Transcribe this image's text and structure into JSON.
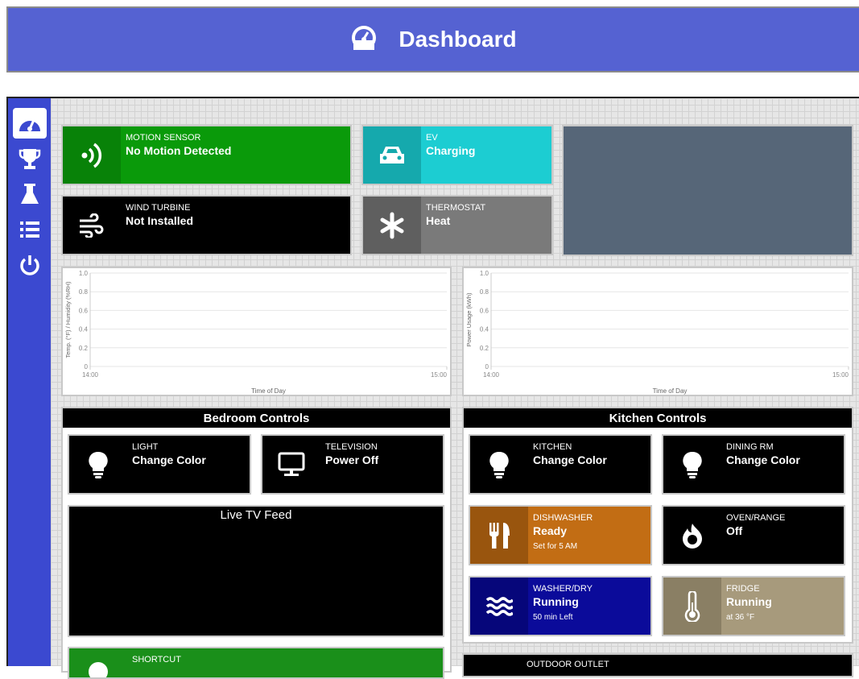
{
  "header": {
    "title": "Dashboard",
    "icon": "gauge-icon"
  },
  "sidebar": {
    "items": [
      {
        "name": "dashboard",
        "icon": "gauge-icon",
        "active": true
      },
      {
        "name": "trophy",
        "icon": "trophy-icon"
      },
      {
        "name": "flask",
        "icon": "flask-icon"
      },
      {
        "name": "list",
        "icon": "list-icon"
      },
      {
        "name": "power",
        "icon": "power-icon"
      }
    ]
  },
  "tiles": {
    "motion": {
      "label": "MOTION SENSOR",
      "value": "No Motion Detected",
      "color": "#0a9a0a",
      "icon_bg": "#088208"
    },
    "ev": {
      "label": "EV",
      "value": "Charging",
      "color": "#1ccdd2",
      "icon_bg": "#15a9ad"
    },
    "wind": {
      "label": "WIND TURBINE",
      "value": "Not Installed",
      "color": "#000000"
    },
    "thermostat": {
      "label": "THERMOSTAT",
      "value": "Heat",
      "color": "#7a7a7a",
      "icon_bg": "#5f5f5f"
    },
    "blank_color": "#566678"
  },
  "charts": [
    {
      "chart_data": {
        "type": "line",
        "ylabel": "Temp. (°F) / Humidity (%RH)",
        "xlabel": "Time of Day",
        "y_ticks": [
          "1.0",
          "0.8",
          "0.6",
          "0.4",
          "0.2",
          "0"
        ],
        "x_ticks": [
          "14:00",
          "15:00"
        ],
        "ylim": [
          0,
          1
        ],
        "series": []
      }
    },
    {
      "chart_data": {
        "type": "line",
        "ylabel": "Power Usage (kWh)",
        "xlabel": "Time of Day",
        "y_ticks": [
          "1.0",
          "0.8",
          "0.6",
          "0.4",
          "0.2",
          "0"
        ],
        "x_ticks": [
          "14:00",
          "15:00"
        ],
        "ylim": [
          0,
          1
        ],
        "series": []
      }
    }
  ],
  "bedroom": {
    "title": "Bedroom Controls",
    "light": {
      "label": "LIGHT",
      "value": "Change Color"
    },
    "tv": {
      "label": "TELEVISION",
      "value": "Power Off"
    },
    "feed": "Live TV Feed",
    "shortcut": {
      "label": "SHORTCUT",
      "color": "#1a8f1a"
    }
  },
  "kitchen": {
    "title": "Kitchen Controls",
    "kitchen_light": {
      "label": "KITCHEN",
      "value": "Change Color"
    },
    "dining": {
      "label": "DINING RM",
      "value": "Change Color"
    },
    "dishwasher": {
      "label": "DISHWASHER",
      "value": "Ready",
      "sub": "Set for 5 AM",
      "color": "#c26d14",
      "icon_bg": "#99550e"
    },
    "oven": {
      "label": "OVEN/RANGE",
      "value": "Off"
    },
    "washer": {
      "label": "WASHER/DRY",
      "value": "Running",
      "sub": "50 min Left",
      "color": "#0b0b9a",
      "icon_bg": "#06067a"
    },
    "fridge": {
      "label": "FRIDGE",
      "value": "Running",
      "sub": "at 36 °F",
      "color": "#a79a7c",
      "icon_bg": "#8a7f64"
    },
    "outdoor": {
      "label": "OUTDOOR OUTLET"
    }
  }
}
